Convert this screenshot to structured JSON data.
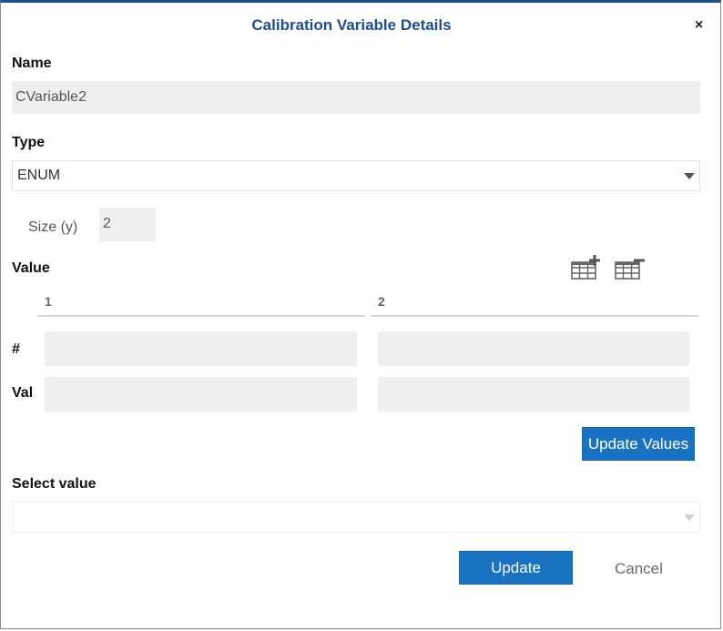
{
  "dialog": {
    "title": "Calibration Variable Details",
    "close_symbol": "×"
  },
  "name": {
    "label": "Name",
    "value": "CVariable2"
  },
  "type": {
    "label": "Type",
    "selected": "ENUM"
  },
  "size": {
    "label": "Size (y)",
    "value": "2"
  },
  "value_section": {
    "label": "Value",
    "add_column_icon": "table-add-icon",
    "remove_column_icon": "table-remove-icon",
    "columns": [
      "1",
      "2"
    ],
    "rows": [
      {
        "label": "#",
        "cells": [
          "",
          ""
        ]
      },
      {
        "label": "Val",
        "cells": [
          "",
          ""
        ]
      }
    ],
    "update_values_label": "Update Values"
  },
  "select_value": {
    "label": "Select value",
    "selected": ""
  },
  "footer": {
    "update_label": "Update",
    "cancel_label": "Cancel"
  },
  "colors": {
    "title": "#1f4e8c",
    "primary_button": "#1a73c2",
    "field_bg": "#efefef"
  }
}
